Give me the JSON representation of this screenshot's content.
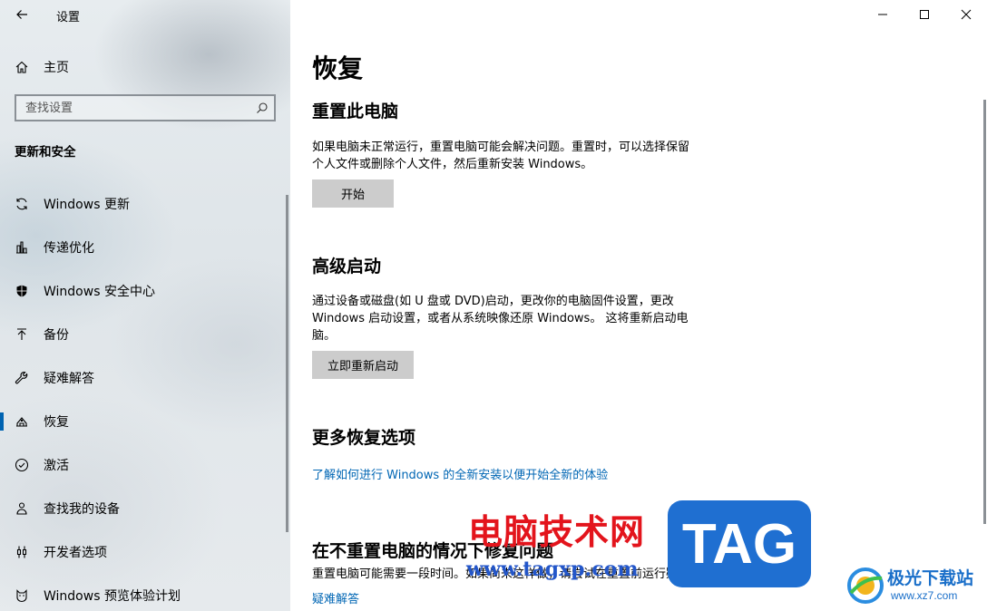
{
  "window": {
    "title": "设置"
  },
  "sidebar": {
    "home_label": "主页",
    "search_placeholder": "查找设置",
    "section_title": "更新和安全",
    "items": [
      {
        "label": "Windows 更新",
        "icon": "sync-icon"
      },
      {
        "label": "传递优化",
        "icon": "delivery-optimization-icon"
      },
      {
        "label": "Windows 安全中心",
        "icon": "shield-icon"
      },
      {
        "label": "备份",
        "icon": "upload-arrow-icon"
      },
      {
        "label": "疑难解答",
        "icon": "wrench-icon"
      },
      {
        "label": "恢复",
        "icon": "recovery-icon",
        "active": true
      },
      {
        "label": "激活",
        "icon": "check-circle-icon"
      },
      {
        "label": "查找我的设备",
        "icon": "person-location-icon"
      },
      {
        "label": "开发者选项",
        "icon": "developer-tools-icon"
      },
      {
        "label": "Windows 预览体验计划",
        "icon": "cat-icon"
      }
    ]
  },
  "content": {
    "page_title": "恢复",
    "reset": {
      "heading": "重置此电脑",
      "line1": "如果电脑未正常运行，重置电脑可能会解决问题。重置时，可以选择保留",
      "line2": "个人文件或删除个人文件，然后重新安装 Windows。",
      "button": "开始"
    },
    "advanced": {
      "heading": "高级启动",
      "line1": "通过设备或磁盘(如 U 盘或 DVD)启动，更改你的电脑固件设置，更改",
      "line2": "Windows 启动设置，或者从系统映像还原 Windows。 这将重新启动电",
      "line3": "脑。",
      "button": "立即重新启动"
    },
    "more": {
      "heading": "更多恢复选项",
      "link": "了解如何进行 Windows 的全新安装以便开始全新的体验"
    },
    "fix": {
      "heading": "在不重置电脑的情况下修复问题",
      "description": "重置电脑可能需要一段时间。如果尚未这样做，请尝试在重置前运行疑难解答来解决问题。",
      "link": "疑难解答"
    }
  },
  "watermarks": {
    "site_cn": "电脑技术网",
    "tag": "TAG",
    "site_url": "www.tagxp.com",
    "brand_name": "极光下载站",
    "brand_url": "www.xz7.com"
  },
  "colors": {
    "accent": "#0063b1",
    "link": "#0066b4",
    "button": "#cccccc"
  }
}
